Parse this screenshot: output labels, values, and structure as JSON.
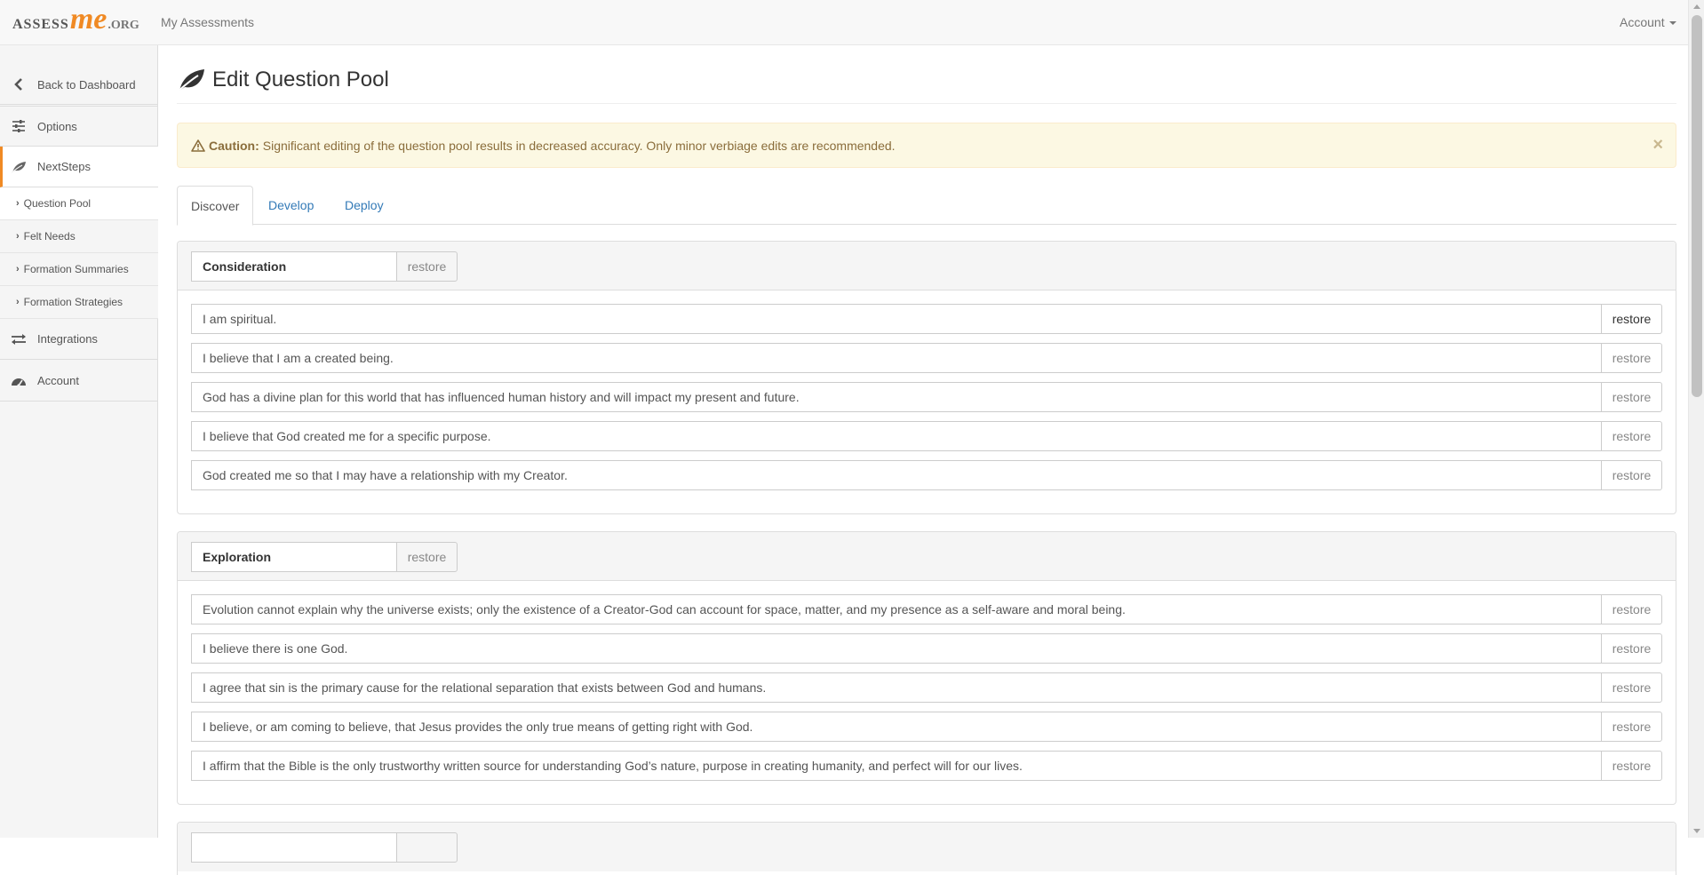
{
  "logo": {
    "part1": "ASSESS",
    "part2": "me",
    "part3": ".ORG"
  },
  "topbar": {
    "my_assessments": "My Assessments",
    "account": "Account"
  },
  "sidebar": {
    "items": [
      {
        "label": "Back to Dashboard",
        "icon": "chevron-left-icon"
      },
      {
        "label": "Options",
        "icon": "sliders-icon"
      },
      {
        "label": "NextSteps",
        "icon": "leaf-icon"
      },
      {
        "label": "Integrations",
        "icon": "exchange-icon"
      },
      {
        "label": "Account",
        "icon": "dashboard-icon"
      }
    ],
    "subitems": [
      "Question Pool",
      "Felt Needs",
      "Formation Summaries",
      "Formation Strategies"
    ]
  },
  "page": {
    "title": "Edit Question Pool"
  },
  "alert": {
    "label": "Caution:",
    "text": "Significant editing of the question pool results in decreased accuracy. Only minor verbiage edits are recommended.",
    "close": "×"
  },
  "tabs": [
    "Discover",
    "Develop",
    "Deploy"
  ],
  "restore_label": "restore",
  "sections": [
    {
      "name": "Consideration",
      "questions": [
        "I am spiritual.",
        "I believe that I am a created being.",
        "God has a divine plan for this world that has influenced human history and will impact my present and future.",
        "I believe that God created me for a specific purpose.",
        "God created me so that I may have a relationship with my Creator."
      ]
    },
    {
      "name": "Exploration",
      "questions": [
        "Evolution cannot explain why the universe exists; only the existence of a Creator-God can account for space, matter, and my presence as a self-aware and moral being.",
        "I believe there is one God.",
        "I agree that sin is the primary cause for the relational separation that exists between God and humans.",
        "I believe, or am coming to believe, that Jesus provides the only true means of getting right with God.",
        "I affirm that the Bible is the only trustworthy written source for understanding God’s nature, purpose in creating humanity, and perfect will for our lives."
      ]
    }
  ]
}
